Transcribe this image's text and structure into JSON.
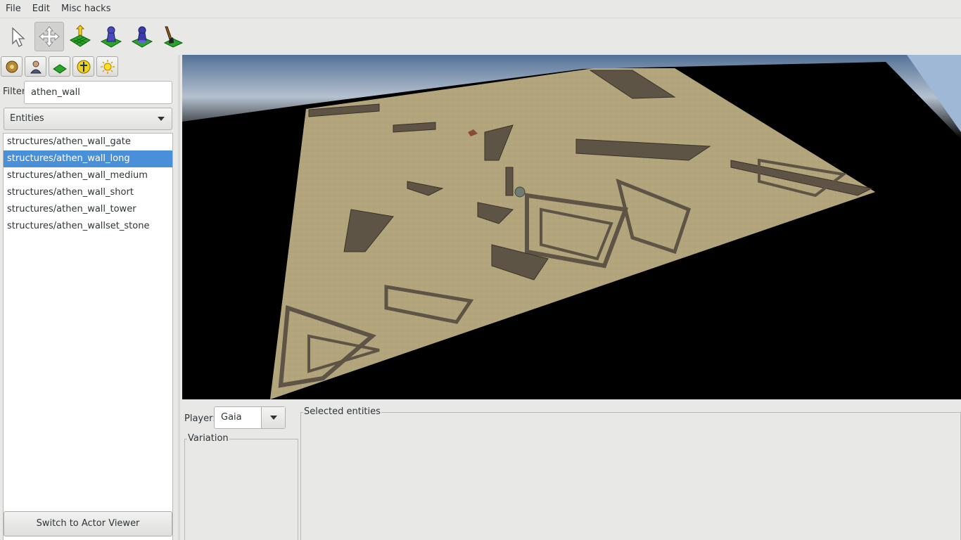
{
  "menu": [
    "File",
    "Edit",
    "Misc hacks"
  ],
  "toolbar": {
    "tools": [
      {
        "icon": "select-cursor-icon"
      },
      {
        "icon": "move-arrows-icon",
        "active": true
      },
      {
        "icon": "terrain-elevation-icon"
      },
      {
        "icon": "place-object-icon"
      },
      {
        "icon": "player-object-icon"
      },
      {
        "icon": "paint-brush-icon"
      }
    ]
  },
  "sidebar": {
    "subtools": [
      "map-settings-icon",
      "player-icon",
      "terrain-icon",
      "object-icon",
      "environment-icon"
    ],
    "filter_label": "Filter",
    "filter_value": "athen_wall",
    "type_combo": "Entities",
    "entities": [
      "structures/athen_wall_gate",
      "structures/athen_wall_long",
      "structures/athen_wall_medium",
      "structures/athen_wall_short",
      "structures/athen_wall_tower",
      "structures/athen_wallset_stone"
    ],
    "selected_index": 1,
    "switch_button": "Switch to Actor Viewer"
  },
  "bottom": {
    "player_label": "Player:",
    "player_value": "Gaia",
    "variation_label": "Variation",
    "selected_label": "Selected entities"
  },
  "colors": {
    "selection": "#4a90d9",
    "terrain": "#b3a57c",
    "walls": "#5e5445"
  }
}
